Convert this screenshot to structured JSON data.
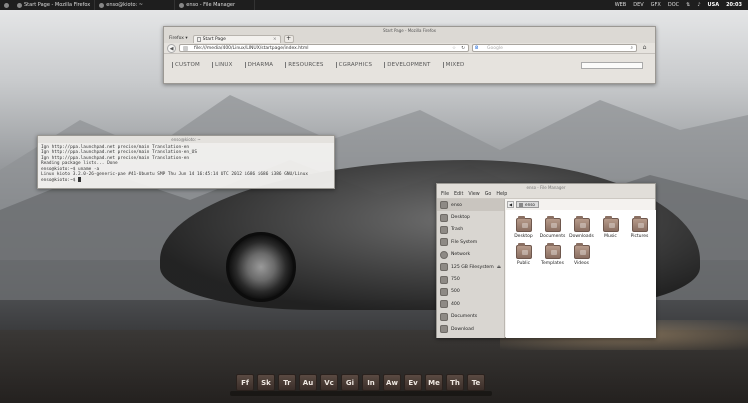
{
  "top_panel": {
    "tasks": [
      {
        "label": "Start Page - Mozilla Firefox"
      },
      {
        "label": "enso@kioto: ~"
      },
      {
        "label": "enso - File Manager"
      }
    ],
    "indicators": [
      "WEB",
      "DEV",
      "GFX",
      "DOC"
    ],
    "keyboard": "USA",
    "clock": "20:03"
  },
  "firefox": {
    "title": "Start Page - Mozilla Firefox",
    "menu_button": "Firefox",
    "tab_label": "Start Page",
    "url": "file:///media/400/Linux/LINUX/startpage/index.html",
    "search_placeholder": "Google",
    "links": [
      "CUSTOM",
      "LINUX",
      "DHARMA",
      "RESOURCES",
      "CGRAPHICS",
      "DEVELOPMENT",
      "MIXED"
    ]
  },
  "terminal": {
    "title": "enso@kioto: ~",
    "lines": [
      "Ign http://ppa.launchpad.net precise/main Translation-en",
      "Ign http://ppa.launchpad.net precise/main Translation-en_US",
      "Ign http://ppa.launchpad.net precise/main Translation-en",
      "Reading package lists... Done",
      "enso@kioto:~$ uname -a",
      "Linux kioto 3.2.0-26-generic-pae #41-Ubuntu SMP Thu Jun 14 16:45:14 UTC 2012 i686 i686 i386 GNU/Linux",
      "enso@kioto:~$ "
    ]
  },
  "file_manager": {
    "title": "enso - File Manager",
    "menu": [
      "File",
      "Edit",
      "View",
      "Go",
      "Help"
    ],
    "path_crumb": "enso",
    "sidebar": [
      {
        "label": "enso",
        "eject": ""
      },
      {
        "label": "Desktop",
        "eject": ""
      },
      {
        "label": "Trash",
        "eject": ""
      },
      {
        "label": "File System",
        "eject": ""
      },
      {
        "label": "Network",
        "eject": ""
      },
      {
        "label": "125 GB Filesystem",
        "eject": "⏏"
      },
      {
        "label": "750",
        "eject": ""
      },
      {
        "label": "500",
        "eject": ""
      },
      {
        "label": "400",
        "eject": ""
      },
      {
        "label": "Documents",
        "eject": ""
      },
      {
        "label": "Download",
        "eject": ""
      }
    ],
    "files": [
      "Desktop",
      "Documents",
      "Downloads",
      "Music",
      "Pictures",
      "Public",
      "Templates",
      "Videos"
    ]
  },
  "dock": [
    "Ff",
    "Sk",
    "Tr",
    "Au",
    "Vc",
    "Gi",
    "In",
    "Aw",
    "Ev",
    "Me",
    "Th",
    "Te"
  ]
}
